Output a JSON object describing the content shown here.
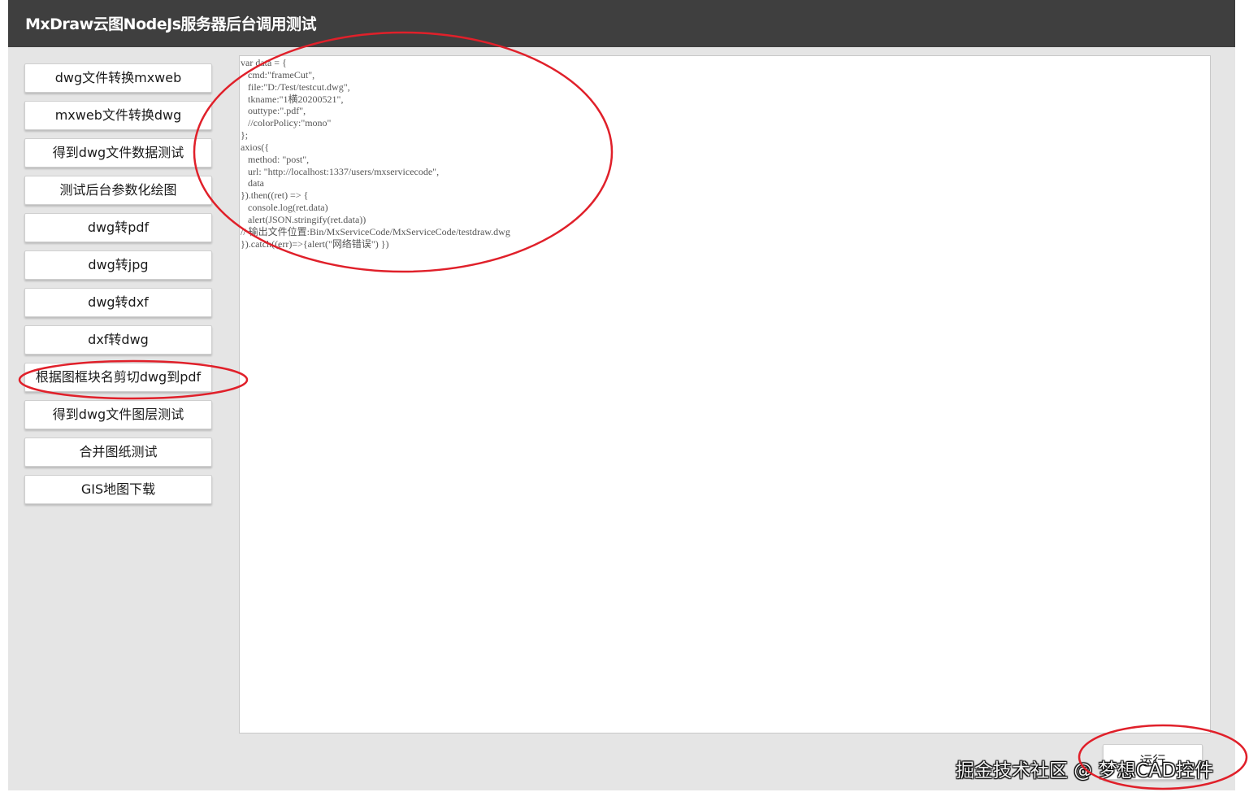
{
  "header": {
    "title": "MxDraw云图NodeJs服务器后台调用测试"
  },
  "sidebar": {
    "buttons": [
      "dwg文件转换mxweb",
      "mxweb文件转换dwg",
      "得到dwg文件数据测试",
      "测试后台参数化绘图",
      "dwg转pdf",
      "dwg转jpg",
      "dwg转dxf",
      "dxf转dwg",
      "根据图框块名剪切dwg到pdf",
      "得到dwg文件图层测试",
      "合并图纸测试",
      "GIS地图下载"
    ]
  },
  "editor": {
    "code": "var data = {\n   cmd:\"frameCut\",\n   file:\"D:/Test/testcut.dwg\",\n   tkname:\"1横20200521\",\n   outtype:\".pdf\",\n   //colorPolicy:\"mono\"\n};\naxios({\n   method: \"post\",\n   url: \"http://localhost:1337/users/mxservicecode\",\n   data\n}).then((ret) => {\n   console.log(ret.data)\n   alert(JSON.stringify(ret.data))\n// 输出文件位置:Bin/MxServiceCode/MxServiceCode/testdraw.dwg\n}).catch((err)=>{alert(\"网络错误\") })"
  },
  "run_button": {
    "label": "运行"
  },
  "watermark": {
    "text": "掘金技术社区 @ 梦想CAD控件"
  },
  "colors": {
    "header_bg": "#3f3f3f",
    "page_bg": "#e5e5e5",
    "annotation_red": "#e0202a"
  }
}
